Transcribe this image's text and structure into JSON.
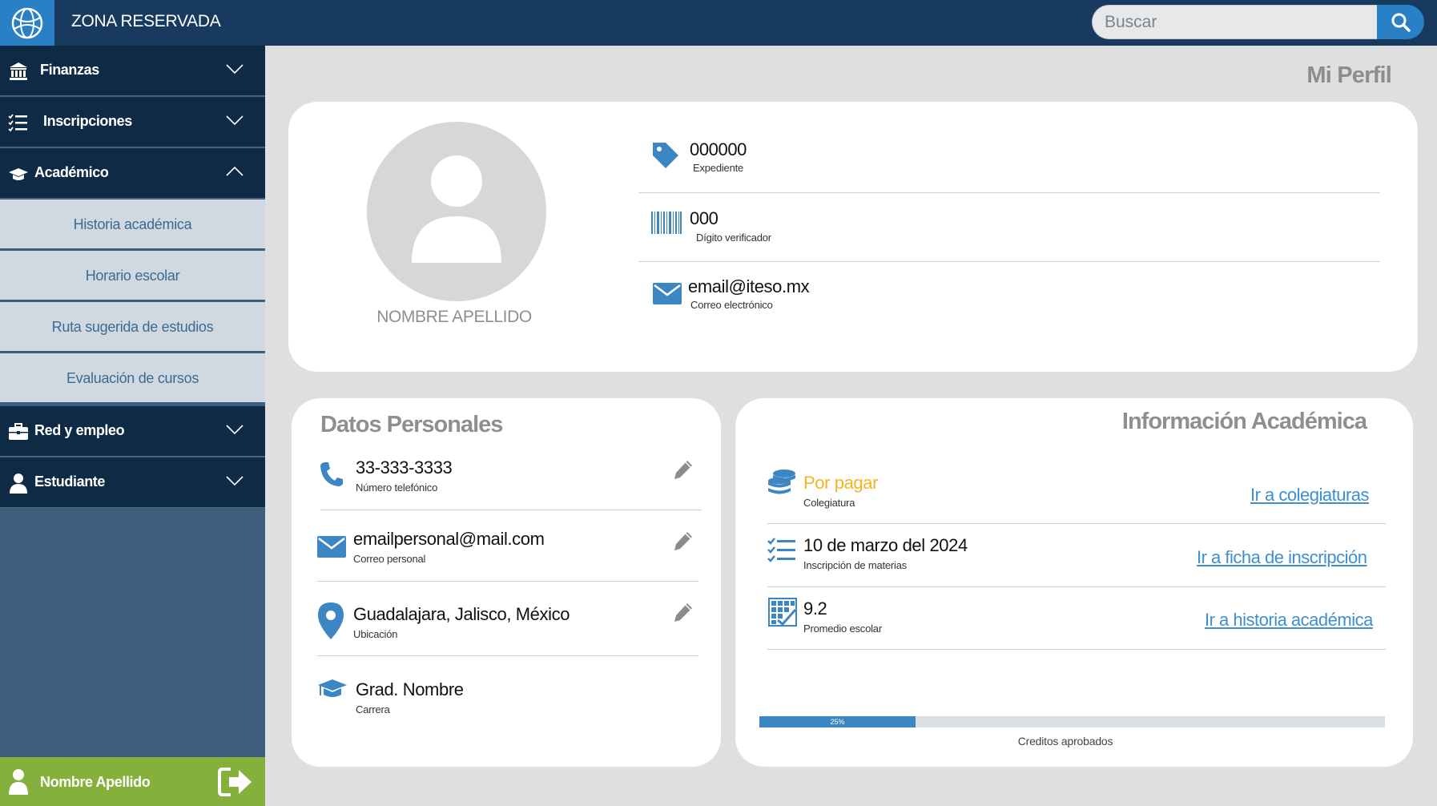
{
  "header": {
    "title": "ZONA RESERVADA",
    "search_placeholder": "Buscar"
  },
  "sidebar": {
    "items": [
      {
        "label": "Finanzas",
        "icon": "bank-icon",
        "expanded": false
      },
      {
        "label": "Inscripciones",
        "icon": "checklist-icon",
        "expanded": false
      },
      {
        "label": "Académico",
        "icon": "graduation-cap-icon",
        "expanded": true,
        "subitems": [
          "Historia académica",
          "Horario escolar",
          "Ruta sugerida de estudios",
          "Evaluación de cursos"
        ]
      },
      {
        "label": "Red y empleo",
        "icon": "briefcase-icon",
        "expanded": false
      },
      {
        "label": "Estudiante",
        "icon": "user-icon",
        "expanded": false
      }
    ],
    "user": {
      "name": "Nombre Apellido",
      "logout_icon": "logout-icon"
    }
  },
  "page": {
    "title": "Mi Perfil"
  },
  "profile": {
    "name": "NOMBRE APELLIDO",
    "fields": [
      {
        "value": "000000",
        "label": "Expediente",
        "icon": "tag-icon"
      },
      {
        "value": "000",
        "label": "Dígito verificador",
        "icon": "barcode-icon"
      },
      {
        "value": "email@iteso.mx",
        "label": "Correo electrónico",
        "icon": "envelope-icon"
      }
    ]
  },
  "personal": {
    "heading": "Datos Personales",
    "fields": [
      {
        "value": "33-333-3333",
        "label": "Número telefónico",
        "icon": "phone-icon"
      },
      {
        "value": "emailpersonal@mail.com",
        "label": "Correo personal",
        "icon": "envelope-icon"
      },
      {
        "value": "Guadalajara, Jalisco, México",
        "label": "Ubicación",
        "icon": "map-pin-icon"
      },
      {
        "value": "Grad. Nombre",
        "label": "Carrera",
        "icon": "graduation-cap-icon"
      }
    ]
  },
  "academic": {
    "heading": "Información Académica",
    "rows": [
      {
        "value": "Por pagar",
        "label": "Colegiatura",
        "link": "Ir a colegiaturas",
        "icon": "coins-icon"
      },
      {
        "value": "10 de marzo del 2024",
        "label": "Inscripción de materias",
        "link": "Ir a ficha de inscripción",
        "icon": "checklist-icon"
      },
      {
        "value": "9.2",
        "label": "Promedio escolar",
        "link": "Ir a historia académica",
        "icon": "grid-check-icon"
      }
    ],
    "progress": {
      "percent_text": "25%",
      "fraction": 0.25,
      "label": "Creditos aprobados"
    }
  },
  "colors": {
    "navy": "#173a5e",
    "accent_blue": "#2a80c4",
    "green": "#86b03c",
    "warning_yellow": "#f2b520"
  }
}
